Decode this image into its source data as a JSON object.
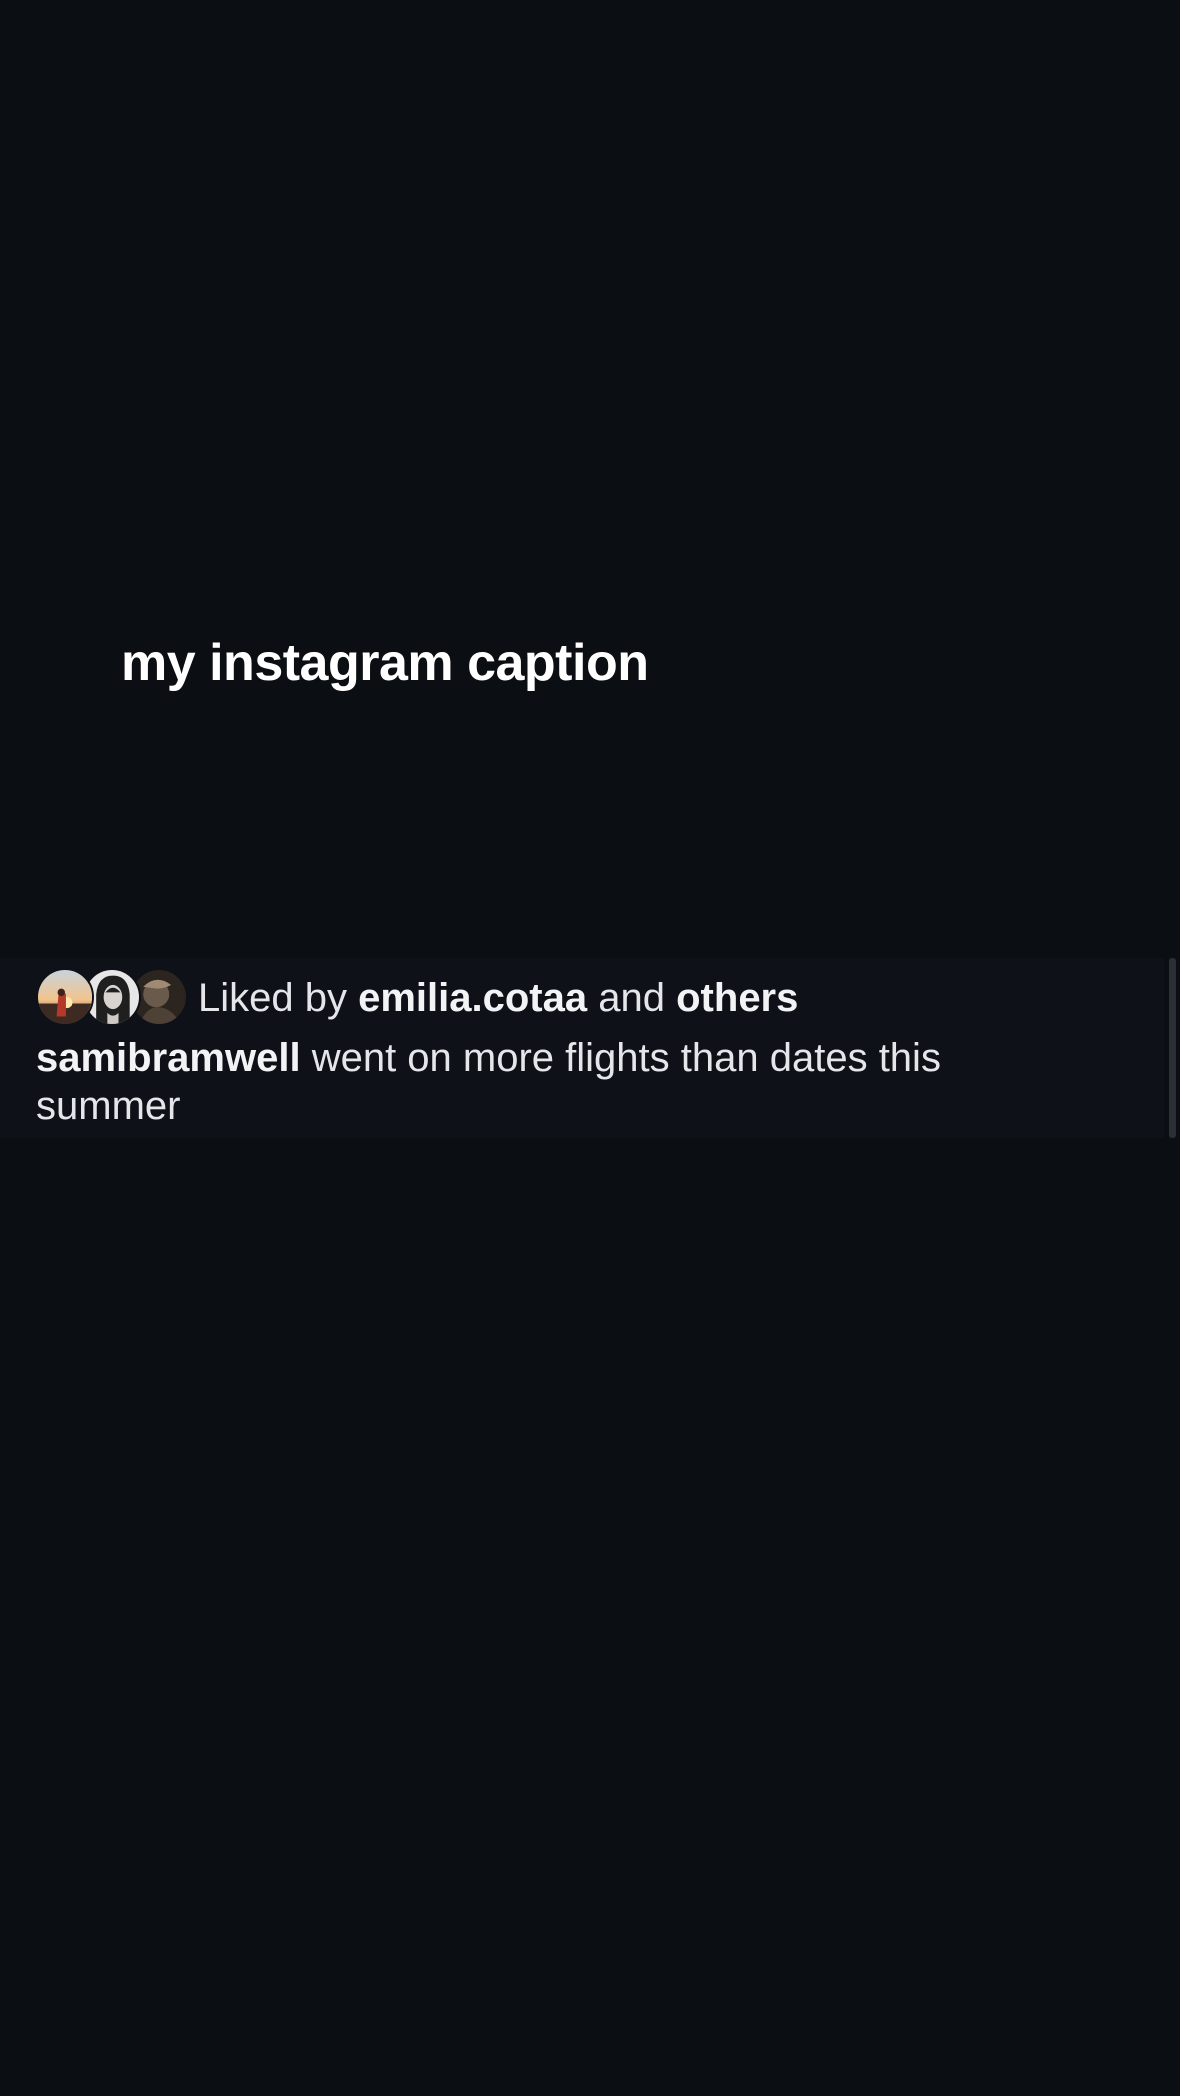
{
  "heading": {
    "title": "my instagram caption"
  },
  "post": {
    "liked_by_prefix": "Liked by",
    "liked_by_user": "emilia.cotaa",
    "liked_by_joiner": "and",
    "liked_by_others": "others",
    "author": "samibramwell",
    "caption": "went on more flights than dates this summer",
    "avatars": [
      "sunset-avatar",
      "portrait-avatar",
      "sepia-avatar"
    ]
  },
  "colors": {
    "background": "#0b0e12",
    "card": "#0e1118",
    "text": "#e4e6ea"
  }
}
